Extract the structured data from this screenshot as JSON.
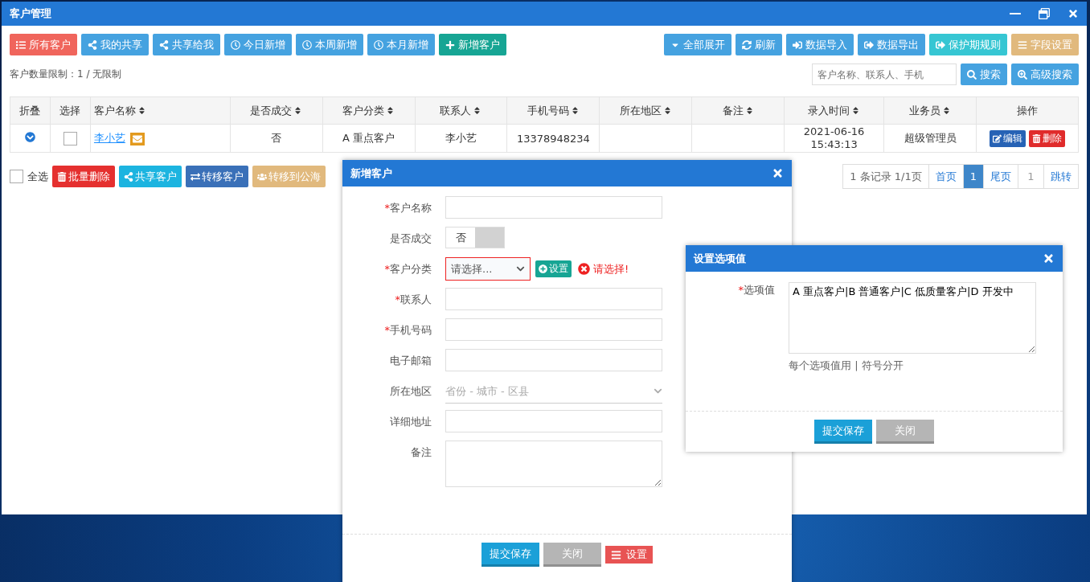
{
  "window": {
    "title": "客户管理"
  },
  "toolbar_left": [
    {
      "label": "所有客户",
      "color": "#f0655c"
    },
    {
      "label": "我的共享",
      "color": "#45a2e0"
    },
    {
      "label": "共享给我",
      "color": "#45a2e0"
    },
    {
      "label": "今日新增",
      "color": "#45a2e0"
    },
    {
      "label": "本周新增",
      "color": "#45a2e0"
    },
    {
      "label": "本月新增",
      "color": "#45a2e0"
    },
    {
      "label": "新增客户",
      "color": "#17a594"
    }
  ],
  "toolbar_right": [
    {
      "label": "全部展开",
      "color": "#45a2e0"
    },
    {
      "label": "刷新",
      "color": "#45a2e0"
    },
    {
      "label": "数据导入",
      "color": "#45a2e0"
    },
    {
      "label": "数据导出",
      "color": "#45a2e0"
    },
    {
      "label": "保护期规则",
      "color": "#36c6d3"
    },
    {
      "label": "字段设置",
      "color": "#e1b97d"
    }
  ],
  "limit_text": "客户数量限制：1 / 无限制",
  "search": {
    "placeholder": "客户名称、联系人、手机",
    "buttons": [
      "搜索",
      "高级搜索"
    ]
  },
  "table": {
    "columns": [
      {
        "label": "折叠",
        "sortable": false
      },
      {
        "label": "选择",
        "sortable": false
      },
      {
        "label": "客户名称",
        "sortable": true
      },
      {
        "label": "是否成交",
        "sortable": true
      },
      {
        "label": "客户分类",
        "sortable": true
      },
      {
        "label": "联系人",
        "sortable": true
      },
      {
        "label": "手机号码",
        "sortable": true
      },
      {
        "label": "所在地区",
        "sortable": true
      },
      {
        "label": "备注",
        "sortable": true
      },
      {
        "label": "录入时间",
        "sortable": true
      },
      {
        "label": "业务员",
        "sortable": true
      },
      {
        "label": "操作",
        "sortable": false
      }
    ],
    "rows": [
      {
        "checked": false,
        "name": "李小艺",
        "deal": "否",
        "category": "A 重点客户",
        "contact": "李小艺",
        "phone": "13378948234",
        "region": "",
        "note": "",
        "time": "2021-06-16 15:43:13",
        "salesperson": "超级管理员",
        "actions": [
          {
            "label": "编辑",
            "color": "#2662b5"
          },
          {
            "label": "删除",
            "color": "#e02b2b"
          }
        ]
      }
    ]
  },
  "bulk": {
    "select_all": {
      "label": "全选",
      "checked": false
    },
    "buttons": [
      {
        "label": "批量删除",
        "color": "#e5302f"
      },
      {
        "label": "共享客户",
        "color": "#1cb4e0"
      },
      {
        "label": "转移客户",
        "color": "#3a70b8"
      },
      {
        "label": "转移到公海",
        "color": "#e1b97d"
      }
    ]
  },
  "pagination": {
    "summary": "1 条记录 1/1页",
    "first": "首页",
    "pages": [
      {
        "label": "1",
        "selected": true
      }
    ],
    "last": "尾页",
    "jump_page": "1",
    "jump": "跳转"
  },
  "add_dialog": {
    "title": "新增客户",
    "fields": [
      {
        "kind": "text",
        "label": "客户名称",
        "required_mark": "*"
      },
      {
        "kind": "toggle",
        "label": "是否成交",
        "value_label": "否",
        "on": false
      },
      {
        "kind": "select",
        "label": "客户分类",
        "required_mark": "*",
        "placeholder": "请选择...",
        "invalid": true,
        "settings_button": "设置",
        "error": "请选择!"
      },
      {
        "kind": "text",
        "label": "联系人",
        "required_mark": "*"
      },
      {
        "kind": "text",
        "label": "手机号码",
        "required_mark": "*"
      },
      {
        "kind": "text",
        "label": "电子邮箱"
      },
      {
        "kind": "region",
        "label": "所在地区",
        "placeholder": "省份 - 城市 - 区县"
      },
      {
        "kind": "text",
        "label": "详细地址"
      },
      {
        "kind": "textarea",
        "label": "备注"
      }
    ],
    "buttons": [
      {
        "kind": "primary",
        "label": "提交保存"
      },
      {
        "kind": "secondary",
        "label": "关闭"
      },
      {
        "kind": "danger",
        "label": "设置"
      }
    ]
  },
  "options_dialog": {
    "title": "设置选项值",
    "label": "选项值",
    "required_mark": "*",
    "value": "A 重点客户|B 普通客户|C 低质量客户|D 开发中",
    "hint": "每个选项值用 | 符号分开",
    "buttons": [
      {
        "kind": "primary",
        "label": "提交保存"
      },
      {
        "kind": "secondary",
        "label": "关闭"
      }
    ]
  }
}
